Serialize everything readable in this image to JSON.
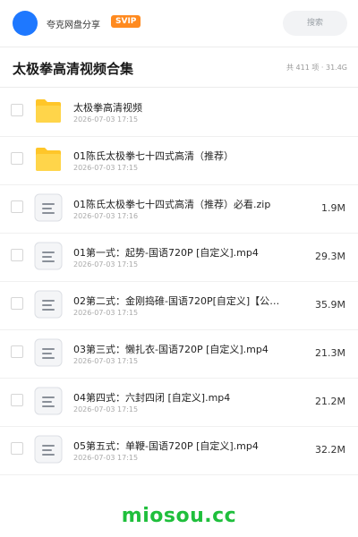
{
  "topbar": {
    "username": "夸克网盘分享",
    "badge": "SVIP",
    "search_placeholder": "搜索",
    "avatar_color": "#1e78ff"
  },
  "header": {
    "title": "太极拳高清视频合集",
    "meta": "共 411 项 · 31.4G"
  },
  "files": [
    {
      "name": "太极拳高清视频",
      "date": "2026-07-03 17:15",
      "size": "",
      "icon": "folder-icon"
    },
    {
      "name": "01陈氏太极拳七十四式高清（推荐）",
      "date": "2026-07-03 17:15",
      "size": "",
      "icon": "folder-icon"
    },
    {
      "name": "01陈氏太极拳七十四式高清（推荐）必看.zip",
      "date": "2026-07-03 17:16",
      "size": "1.9M",
      "icon": "file-icon"
    },
    {
      "name": "01第一式：起势-国语720P [自定义].mp4",
      "date": "2026-07-03 17:15",
      "size": "29.3M",
      "icon": "file-icon"
    },
    {
      "name": "02第二式：金刚捣碓-国语720P[自定义]【公众…",
      "date": "2026-07-03 17:15",
      "size": "35.9M",
      "icon": "file-icon"
    },
    {
      "name": "03第三式：懒扎衣-国语720P [自定义].mp4",
      "date": "2026-07-03 17:15",
      "size": "21.3M",
      "icon": "file-icon"
    },
    {
      "name": "04第四式：六封四闭 [自定义].mp4",
      "date": "2026-07-03 17:15",
      "size": "21.2M",
      "icon": "file-icon"
    },
    {
      "name": "05第五式：单鞭-国语720P [自定义].mp4",
      "date": "2026-07-03 17:15",
      "size": "32.2M",
      "icon": "file-icon"
    }
  ],
  "footer": {
    "brand": "miosou.cc",
    "brand_color": "#1fbf3c"
  }
}
